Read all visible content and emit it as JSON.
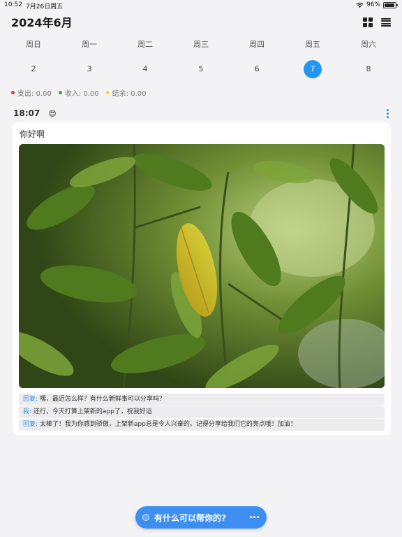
{
  "status_bar": {
    "time": "10:52",
    "date": "7月26日周五",
    "battery": "96%",
    "battery_level": 0.96
  },
  "header": {
    "month_title": "2024年6月",
    "icons": [
      "grid-view-icon",
      "list-view-icon"
    ]
  },
  "week": {
    "days": [
      {
        "name": "周日",
        "num": "2"
      },
      {
        "name": "周一",
        "num": "3"
      },
      {
        "name": "周二",
        "num": "4"
      },
      {
        "name": "周三",
        "num": "5"
      },
      {
        "name": "周四",
        "num": "6"
      },
      {
        "name": "周五",
        "num": "7"
      },
      {
        "name": "周六",
        "num": "8"
      }
    ],
    "selected_num": "7"
  },
  "summary": {
    "expense": "支出: 0.00",
    "income": "收入: 0.00",
    "balance": "结余: 0.00",
    "colors": {
      "expense": "#e53935",
      "income": "#43a047",
      "balance": "#fdd835"
    }
  },
  "entry": {
    "time": "18:07",
    "mood_icon": "😍",
    "title": "你好啊",
    "replies": [
      {
        "who": "回复:",
        "text": " 嘿，最近怎么样？有什么新鲜事可以分享吗？"
      },
      {
        "who": "我:",
        "text": " 还行，今天打算上架新的app了，祝我好运"
      },
      {
        "who": "回复:",
        "text": " 太棒了！我为你感到骄傲，上架新app总是令人兴奋的。记得分享给我们它的亮点哦！加油！"
      }
    ]
  },
  "assistant": {
    "label": "有什么可以帮你的?"
  },
  "colors": {
    "accent": "#2196f3",
    "assist_button": "#3d8ef0",
    "background": "#f3f3f5"
  }
}
